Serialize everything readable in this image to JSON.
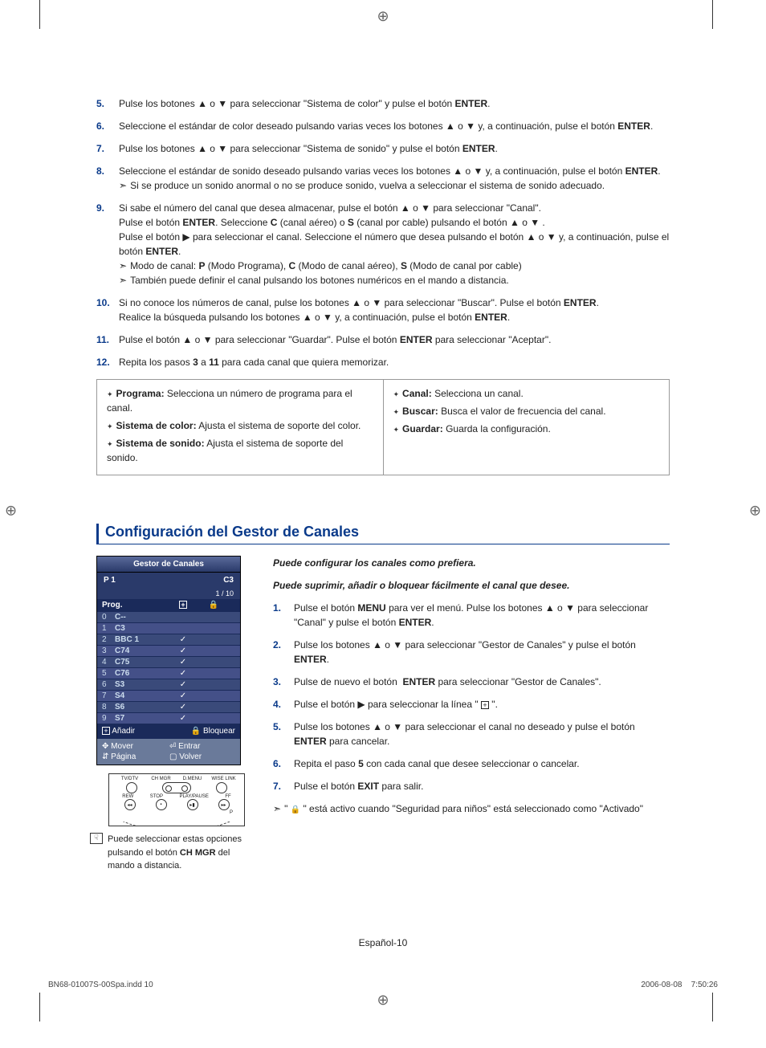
{
  "steps_top": [
    {
      "n": "5.",
      "html": "Pulse los botones ▲ o ▼ para seleccionar \"Sistema de color\" y pulse el botón <b>ENTER</b>."
    },
    {
      "n": "6.",
      "html": "Seleccione el estándar de color deseado pulsando varias veces los botones ▲ o ▼ y, a continuación, pulse el botón <b>ENTER</b>."
    },
    {
      "n": "7.",
      "html": "Pulse los botones ▲ o ▼ para seleccionar \"Sistema de sonido\" y pulse el botón <b>ENTER</b>."
    },
    {
      "n": "8.",
      "html": "Seleccione el estándar de sonido deseado pulsando varias veces los botones ▲ o ▼ y, a continuación, pulse el botón <b>ENTER</b>.<br><span class='note-arrow'></span>Si se produce un sonido anormal o no se produce sonido, vuelva a seleccionar el sistema de sonido adecuado."
    },
    {
      "n": "9.",
      "html": "Si sabe el número del canal que desea almacenar, pulse el botón ▲ o ▼ para seleccionar \"Canal\".<br>Pulse el botón <b>ENTER</b>. Seleccione <b>C</b> (canal aéreo) o <b>S</b> (canal por cable) pulsando el botón ▲ o ▼ .<br>Pulse el botón ▶ para seleccionar el canal. Seleccione el número que desea pulsando el botón ▲ o ▼ y, a continuación, pulse el botón <b>ENTER</b>.<br><span class='note-arrow'></span>Modo de canal: <b>P</b> (Modo Programa), <b>C</b> (Modo de canal aéreo), <b>S</b> (Modo de canal por cable)<br><span class='note-arrow'></span>También puede definir el canal pulsando los botones numéricos en el mando a distancia."
    },
    {
      "n": "10.",
      "html": "Si no conoce los números de canal, pulse los botones ▲ o ▼ para seleccionar \"Buscar\". Pulse el botón <b>ENTER</b>.<br>Realice la búsqueda pulsando los botones ▲ o ▼ y, a continuación, pulse el botón <b>ENTER</b>."
    },
    {
      "n": "11.",
      "html": "Pulse el botón ▲ o ▼ para seleccionar \"Guardar\". Pulse el botón <b>ENTER</b> para seleccionar \"Aceptar\"."
    },
    {
      "n": "12.",
      "html": "Repita los pasos <b>3</b> a <b>11</b> para cada canal que quiera memorizar."
    }
  ],
  "defs_left": [
    {
      "html": "<b>Programa:</b> Selecciona un número de programa para el canal."
    },
    {
      "html": "<b>Sistema de color:</b> Ajusta el sistema de soporte del color."
    },
    {
      "html": "<b>Sistema de sonido:</b> Ajusta el sistema de soporte del sonido."
    }
  ],
  "defs_right": [
    {
      "html": "<b>Canal:</b> Selecciona un canal."
    },
    {
      "html": "<b>Buscar:</b> Busca el valor de frecuencia del canal."
    },
    {
      "html": "<b>Guardar:</b> Guarda la configuración."
    }
  ],
  "section_title": "Configuración del Gestor de Canales",
  "intro1": "Puede configurar los canales como prefiera.",
  "intro2": "Puede suprimir, añadir o bloquear fácilmente el canal que desee.",
  "osd": {
    "title": "Gestor de Canales",
    "sub_left": "P 1",
    "sub_right": "C3",
    "count": "1 / 10",
    "hdr_prog": "Prog.",
    "rows": [
      {
        "n": "0",
        "ch": "C--",
        "add": "",
        "lock": ""
      },
      {
        "n": "1",
        "ch": "C3",
        "add": "",
        "lock": ""
      },
      {
        "n": "2",
        "ch": "BBC 1",
        "add": "✓",
        "lock": ""
      },
      {
        "n": "3",
        "ch": "C74",
        "add": "✓",
        "lock": ""
      },
      {
        "n": "4",
        "ch": "C75",
        "add": "✓",
        "lock": ""
      },
      {
        "n": "5",
        "ch": "C76",
        "add": "✓",
        "lock": ""
      },
      {
        "n": "6",
        "ch": "S3",
        "add": "✓",
        "lock": ""
      },
      {
        "n": "7",
        "ch": "S4",
        "add": "✓",
        "lock": ""
      },
      {
        "n": "8",
        "ch": "S6",
        "add": "✓",
        "lock": ""
      },
      {
        "n": "9",
        "ch": "S7",
        "add": "✓",
        "lock": ""
      }
    ],
    "act_add": "Añadir",
    "act_lock": "Bloquear",
    "help_move": "Mover",
    "help_enter": "Entrar",
    "help_page": "Página",
    "help_return": "Volver"
  },
  "remote": {
    "r1": [
      "TV/DTV",
      "CH MGR",
      "D.MENU",
      "WISE LINK"
    ],
    "r3": [
      "REW",
      "STOP",
      "PLAY/PAUSE",
      "FF"
    ],
    "p_label": "P"
  },
  "side_caption_html": "Puede seleccionar estas opciones pulsando el botón <b>CH MGR</b> del mando a distancia.",
  "steps_right": [
    {
      "n": "1.",
      "html": "Pulse el botón <b>MENU</b> para ver el menú. Pulse los botones ▲ o ▼ para seleccionar \"Canal\" y pulse el botón <b>ENTER</b>."
    },
    {
      "n": "2.",
      "html": "Pulse los botones ▲ o ▼ para seleccionar \"Gestor de Canales\" y pulse el botón <b>ENTER</b>."
    },
    {
      "n": "3.",
      "html": "Pulse de nuevo el botón &nbsp;<b>ENTER</b> para seleccionar \"Gestor de Canales\"."
    },
    {
      "n": "4.",
      "html": "Pulse el botón ▶ para seleccionar la línea \" <span class='plus-box'>+</span> \"."
    },
    {
      "n": "5.",
      "html": "Pulse los botones ▲ o ▼ para seleccionar el canal no deseado y pulse el  botón <b>ENTER</b> para cancelar."
    },
    {
      "n": "6.",
      "html": "Repita el paso <b>5</b> con cada canal que desee seleccionar o cancelar."
    },
    {
      "n": "7.",
      "html": "Pulse el botón <b>EXIT</b> para salir."
    }
  ],
  "lock_note_html": "\" <span class='lock-ico'>🔒</span> \" está activo cuando \"Seguridad para niños\" está seleccionado como \"Activado\"",
  "page_label": "Español-10",
  "footer_file": "BN68-01007S-00Spa.indd   10",
  "footer_date": "2006-08-08",
  "footer_time": "7:50:26"
}
